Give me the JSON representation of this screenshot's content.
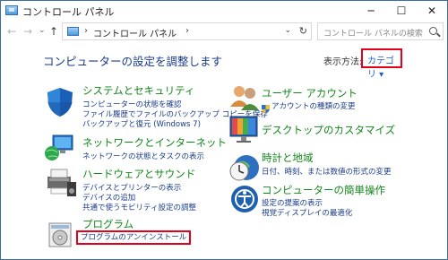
{
  "window": {
    "title": "コントロール パネル",
    "controls": {
      "minimize": "─",
      "maximize": "☐",
      "close": "✕"
    }
  },
  "nav": {
    "back": "←",
    "forward": "→",
    "dropdown": "⌄",
    "up": "↑",
    "breadcrumb": "コントロール パネル",
    "breadcrumb_sep": "›",
    "breadcrumb_sep_end": "›",
    "address_dropdown": "⌄",
    "refresh": "↻",
    "search_placeholder": "コントロール パネルの検索"
  },
  "main": {
    "heading": "コンピューターの設定を調整します",
    "view_by_label": "表示方法:",
    "view_by_value": "カテゴリ ▾",
    "highlight_color": "#e3001b",
    "categories": [
      {
        "title": "システムとセキュリティ",
        "icon": "shield-icon",
        "links": [
          "コンピューターの状態を確認",
          "ファイル履歴でファイルのバックアップ コピーを保存",
          "バックアップと復元 (Windows 7)"
        ]
      },
      {
        "title": "ネットワークとインターネット",
        "icon": "network-globe-icon",
        "links": [
          "ネットワークの状態とタスクの表示"
        ]
      },
      {
        "title": "ハードウェアとサウンド",
        "icon": "printer-speaker-icon",
        "links": [
          "デバイスとプリンターの表示",
          "デバイスの追加",
          "共通で使うモビリティ設定の調整"
        ]
      },
      {
        "title": "プログラム",
        "icon": "program-disc-icon",
        "links": [
          "プログラムのアンインストール"
        ]
      },
      {
        "title": "ユーザー アカウント",
        "icon": "users-icon",
        "links": [
          "アカウントの種類の変更"
        ]
      },
      {
        "title": "デスクトップのカスタマイズ",
        "icon": "desktop-icon",
        "links": []
      },
      {
        "title": "時計と地域",
        "icon": "clock-globe-icon",
        "links": [
          "日付、時刻、または数値の形式の変更"
        ]
      },
      {
        "title": "コンピューターの簡単操作",
        "icon": "ease-of-access-icon",
        "links": [
          "設定の提案の表示",
          "視覚ディスプレイの最適化"
        ]
      }
    ]
  }
}
